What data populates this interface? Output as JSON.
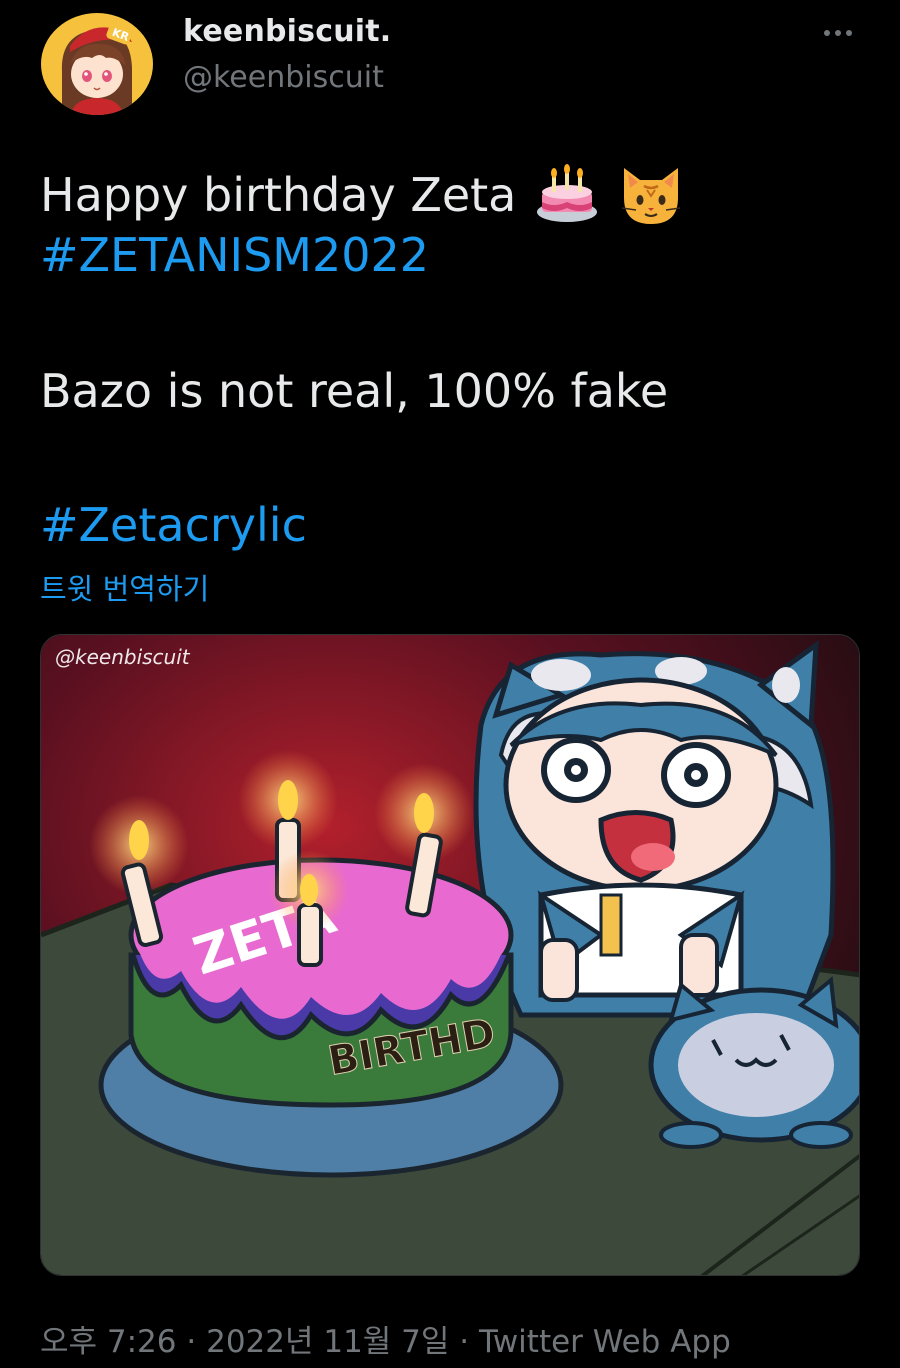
{
  "user": {
    "display_name": "keenbiscuit.",
    "handle": "@keenbiscuit",
    "avatar_badge": "KR"
  },
  "tweet": {
    "text_line1": "Happy birthday Zeta",
    "emoji_1": "birthday-cake",
    "emoji_2": "cat-face",
    "hashtag_1": "#ZETANISM2022",
    "text_line3": "Bazo is not real, 100% fake",
    "hashtag_2": "#Zetacrylic",
    "translate_label": "트윗 번역하기"
  },
  "media": {
    "watermark": "@keenbiscuit",
    "cake_text_top": "ZETA",
    "cake_text_side": "BIRTHD"
  },
  "meta": {
    "time": "오후 7:26",
    "separator_1": "·",
    "date": "2022년 11월 7일",
    "separator_2": "·",
    "source": "Twitter Web App"
  },
  "colors": {
    "background": "#000000",
    "text": "#e7e9ea",
    "secondary": "#71767b",
    "link": "#1d9bf0"
  },
  "icons": {
    "more": "more-horizontal-icon"
  }
}
